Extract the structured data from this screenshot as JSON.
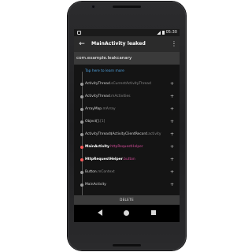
{
  "status_bar": {
    "time": "05:30"
  },
  "toolbar": {
    "back_icon": "arrow-back-icon",
    "title": "MainActivity leaked",
    "more_icon": "more-vert-icon"
  },
  "header": {
    "package": "com.example.leakcanary"
  },
  "hint": {
    "text": "Tap here to learn more"
  },
  "leak_trace": [
    {
      "cls": "ActivityThread",
      "field": ".sCurrentActivityThread",
      "type": "normal",
      "dot": "grey"
    },
    {
      "cls": "ActivityThread",
      "field": ".mActivities",
      "type": "normal",
      "dot": "grey"
    },
    {
      "cls": "ArrayMap",
      "field": ".mArray",
      "type": "normal",
      "dot": "grey"
    },
    {
      "cls": "Object[]",
      "field": ".[1]",
      "type": "normal",
      "dot": "grey"
    },
    {
      "cls": "ActivityThread$ActivityClientRecord",
      "field": ".activity",
      "type": "normal",
      "dot": "grey"
    },
    {
      "cls": "MainActivity",
      "field": ".httpRequestHelper",
      "type": "leak",
      "dot": "red"
    },
    {
      "cls": "HttpRequestHelper",
      "field": ".button",
      "type": "leak",
      "dot": "red"
    },
    {
      "cls": "Button",
      "field": ".mContext",
      "type": "normal",
      "dot": "grey"
    },
    {
      "cls": "MainActivity",
      "field": "",
      "type": "normal",
      "dot": "grey"
    }
  ],
  "expand_label": "+",
  "delete_button": {
    "label": "DELETE"
  },
  "colors": {
    "toolbar": "#2b2b2b",
    "header": "#3a3a3a",
    "screen_bg": "#141414",
    "hint": "#4fa3e0",
    "leak_field": "#d64c9b",
    "leak_dot": "#ff5a5a"
  }
}
